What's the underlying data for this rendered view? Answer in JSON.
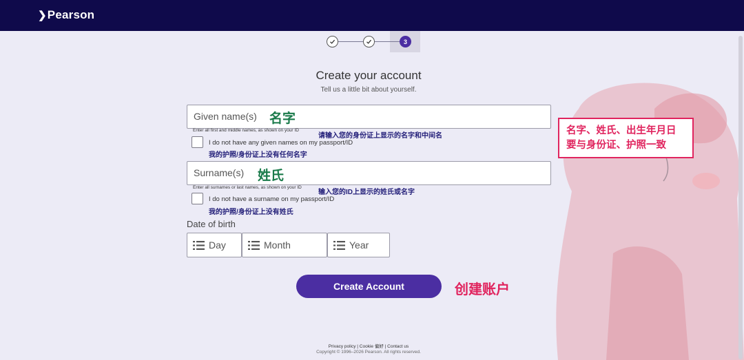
{
  "header": {
    "logo_text": "Pearson"
  },
  "stepper": {
    "active_step": "3"
  },
  "form": {
    "title": "Create your account",
    "subtitle": "Tell us a little bit about yourself.",
    "given_name": {
      "placeholder": "Given name(s)",
      "help": "Enter all first and middle names, as shown on your ID",
      "no_name_label": "I do not have any given names on my passport/ID"
    },
    "surname": {
      "placeholder": "Surname(s)",
      "help": "Enter all surnames or last names, as shown on your ID",
      "no_name_label": "I do not have a surname on my passport/ID"
    },
    "dob": {
      "label": "Date of birth",
      "day": "Day",
      "month": "Month",
      "year": "Year"
    },
    "submit_label": "Create Account"
  },
  "annotations": {
    "given_name": "名字",
    "given_help": "请输入您的身份证上显示的名字和中间名",
    "no_given": "我的护照/身份证上没有任何名字",
    "surname": "姓氏",
    "surname_help": "输入您的ID上显示的姓氏或名字",
    "no_surname": "我的护照/身份证上没有姓氏",
    "create_account": "创建账户",
    "note_line1": "名字、姓氏、出生年月日",
    "note_line2": "要与身份证、护照一致"
  },
  "footer": {
    "links": "Privacy policy | Cookie 偏好 | Contact us",
    "copyright": "Copyright © 1996–2026 Pearson. All rights reserved."
  },
  "colors": {
    "header_bg": "#0f0a4b",
    "accent": "#4b2ea2",
    "annotation_red": "#e0245e",
    "annotation_green": "#1a7a4a"
  }
}
